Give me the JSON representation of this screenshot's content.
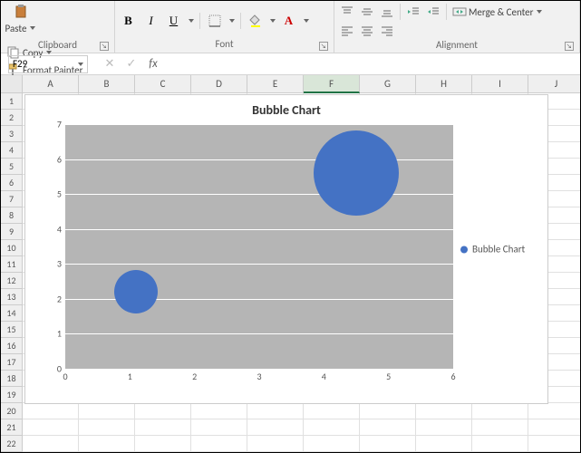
{
  "ribbon": {
    "clipboard": {
      "paste": "Paste",
      "copy": "Copy",
      "format_painter": "Format Painter",
      "group_label": "Clipboard"
    },
    "font": {
      "group_label": "Font",
      "bold": "B",
      "italic": "I",
      "underline": "U"
    },
    "alignment": {
      "group_label": "Alignment",
      "merge": "Merge & Center"
    }
  },
  "namebox": {
    "value": "F29"
  },
  "formula_bar": {
    "fx": "fx"
  },
  "columns": [
    "A",
    "B",
    "C",
    "D",
    "E",
    "F",
    "G",
    "H",
    "I",
    "J"
  ],
  "selected_col": "F",
  "row_count": 22,
  "chart_data": {
    "type": "bubble",
    "title": "Bubble Chart",
    "legend": "Bubble Chart",
    "xlim": [
      0,
      6
    ],
    "ylim": [
      0,
      7
    ],
    "xticks": [
      0,
      1,
      2,
      3,
      4,
      5,
      6
    ],
    "yticks": [
      0,
      1,
      2,
      3,
      4,
      5,
      6,
      7
    ],
    "series": [
      {
        "x": 1.1,
        "y": 2.2,
        "size": 48
      },
      {
        "x": 4.5,
        "y": 5.6,
        "size": 94
      }
    ],
    "color": "#4472c4"
  }
}
